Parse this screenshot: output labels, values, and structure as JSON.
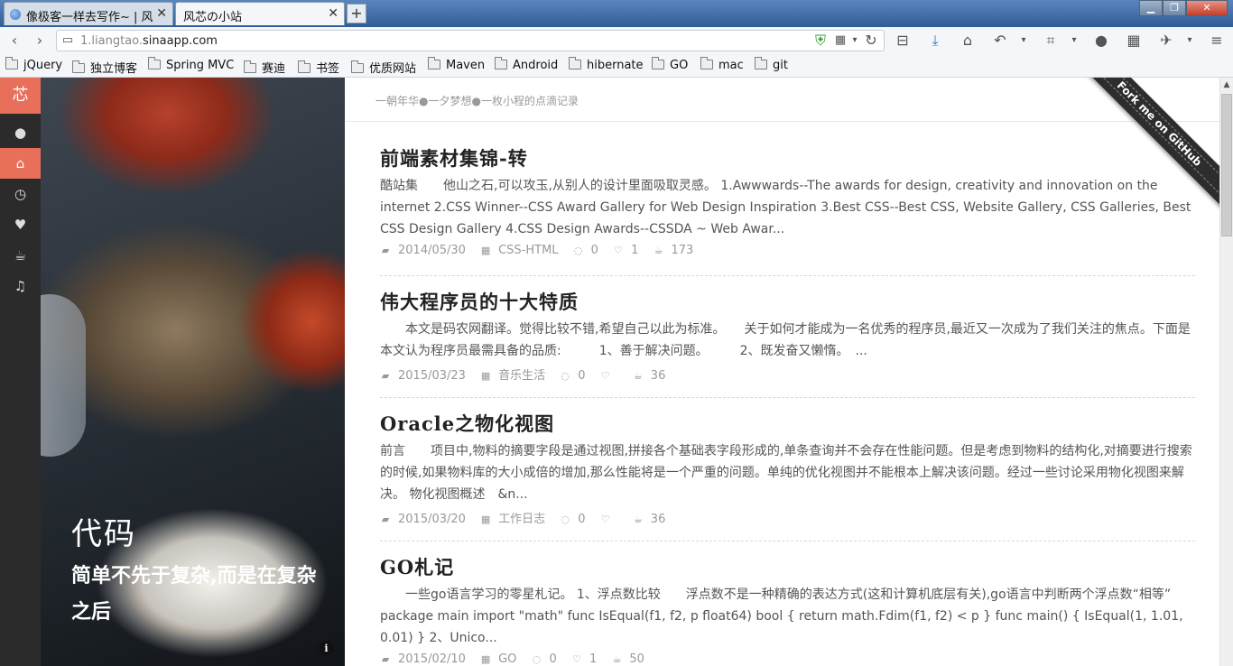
{
  "browser": {
    "tabs": [
      {
        "label": "像极客一样去写作~ | 风...",
        "active": false
      },
      {
        "label": "风芯の小站",
        "active": true
      }
    ],
    "new_tab": "+",
    "url_prefix": "1.liangtao.",
    "url_domain": "sinaapp.com",
    "bookmarks": [
      "jQuery",
      "独立博客",
      "Spring MVC",
      "赛迪",
      "书签",
      "优质网站",
      "Maven",
      "Android",
      "hibernate",
      "GO",
      "mac",
      "git"
    ]
  },
  "sidebar": {
    "logo": "芯",
    "icons": [
      "user-icon",
      "home-icon",
      "clock-icon",
      "heart-icon",
      "coffee-icon",
      "music-icon"
    ]
  },
  "hero": {
    "title": "代码",
    "subtitle": "简单不先于复杂,而是在复杂之后",
    "info": "i"
  },
  "header": {
    "tagline": "一朝年华●一夕梦想●一枚小程的点滴记录",
    "ribbon": "Fork me on GitHub"
  },
  "posts": [
    {
      "title": "前端素材集锦-转",
      "excerpt": "酷站集　　他山之石,可以攻玉,从别人的设计里面吸取灵感。 1.Awwwards--The awards for design, creativity and innovation on the internet 2.CSS Winner--CSS Award Gallery for Web Design Inspiration 3.Best CSS--Best CSS, Website Gallery, CSS Galleries, Best CSS Design Gallery 4.CSS Design Awards--CSSDA ~ Web Awar...",
      "date": "2014/05/30",
      "category": "CSS-HTML",
      "comments": "0",
      "likes": "1",
      "views": "173"
    },
    {
      "title": "伟大程序员的十大特质",
      "excerpt": "　　本文是码农网翻译。觉得比较不错,希望自己以此为标准。　　关于如何才能成为一名优秀的程序员,最近又一次成为了我们关注的焦点。下面是本文认为程序员最需具备的品质:　　　1、善于解决问题。　　　2、既发奋又懒惰。　...",
      "date": "2015/03/23",
      "category": "音乐生活",
      "comments": "0",
      "likes": "",
      "views": "36"
    },
    {
      "title": "Oracle之物化视图",
      "excerpt": "前言　　项目中,物料的摘要字段是通过视图,拼接各个基础表字段形成的,单条查询并不会存在性能问题。但是考虑到物料的结构化,对摘要进行搜索的时候,如果物料库的大小成倍的增加,那么性能将是一个严重的问题。单纯的优化视图并不能根本上解决该问题。经过一些讨论采用物化视图来解决。 物化视图概述　&n...",
      "date": "2015/03/20",
      "category": "工作日志",
      "comments": "0",
      "likes": "",
      "views": "36"
    },
    {
      "title": "GO札记",
      "excerpt": "　　一些go语言学习的零星札记。 1、浮点数比较　　浮点数不是一种精确的表达方式(这和计算机底层有关),go语言中判断两个浮点数“相等” package main import \"math\" func IsEqual(f1, f2, p float64) bool { return math.Fdim(f1, f2) < p } func main() { IsEqual(1, 1.01, 0.01) } 2、Unico...",
      "date": "2015/02/10",
      "category": "GO",
      "comments": "0",
      "likes": "1",
      "views": "50"
    }
  ]
}
